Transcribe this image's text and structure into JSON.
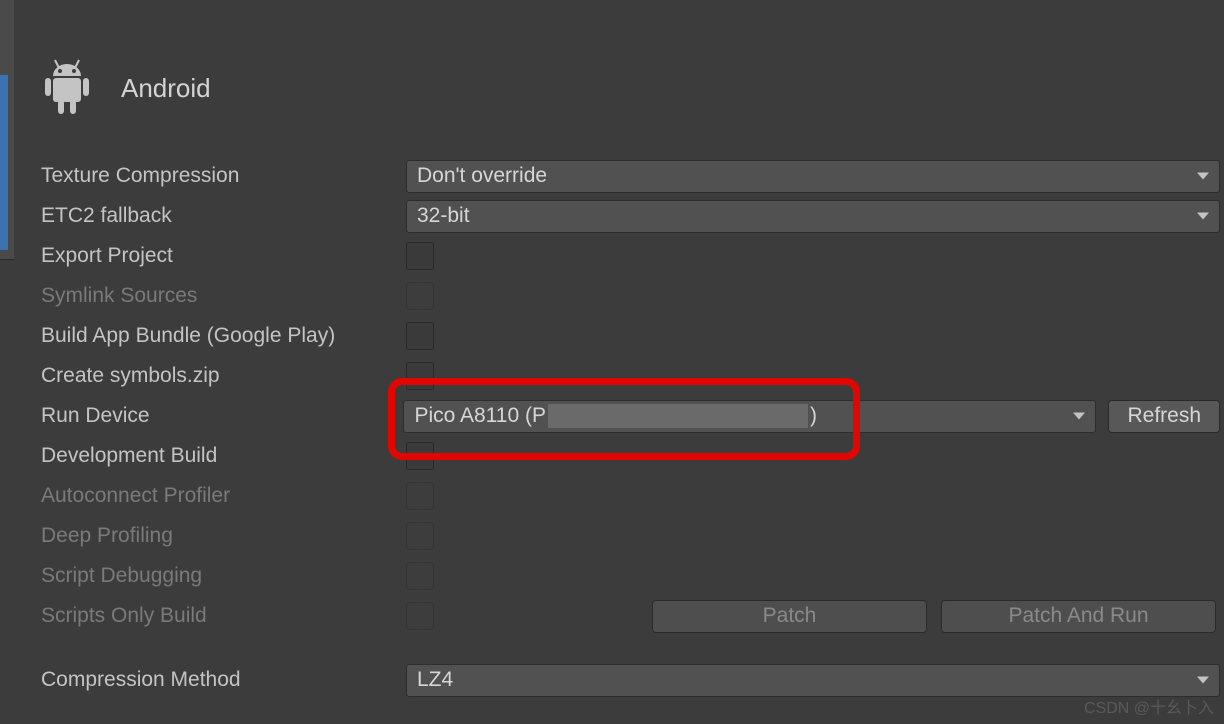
{
  "platform": {
    "title": "Android"
  },
  "fields": {
    "texture_compression": {
      "label": "Texture Compression",
      "value": "Don't override"
    },
    "etc2_fallback": {
      "label": "ETC2 fallback",
      "value": "32-bit"
    },
    "export_project": {
      "label": "Export Project"
    },
    "symlink_sources": {
      "label": "Symlink Sources"
    },
    "build_app_bundle": {
      "label": "Build App Bundle (Google Play)"
    },
    "create_symbols": {
      "label": "Create symbols.zip"
    },
    "run_device": {
      "label": "Run Device",
      "value_prefix": "Pico A8110 (P",
      "value_suffix": ")",
      "refresh": "Refresh"
    },
    "development_build": {
      "label": "Development Build"
    },
    "autoconnect_profiler": {
      "label": "Autoconnect Profiler"
    },
    "deep_profiling": {
      "label": "Deep Profiling"
    },
    "script_debugging": {
      "label": "Script Debugging"
    },
    "scripts_only_build": {
      "label": "Scripts Only Build",
      "patch": "Patch",
      "patch_run": "Patch And Run"
    },
    "compression_method": {
      "label": "Compression Method",
      "value": "LZ4"
    }
  },
  "watermark": "CSDN @十幺卜入"
}
